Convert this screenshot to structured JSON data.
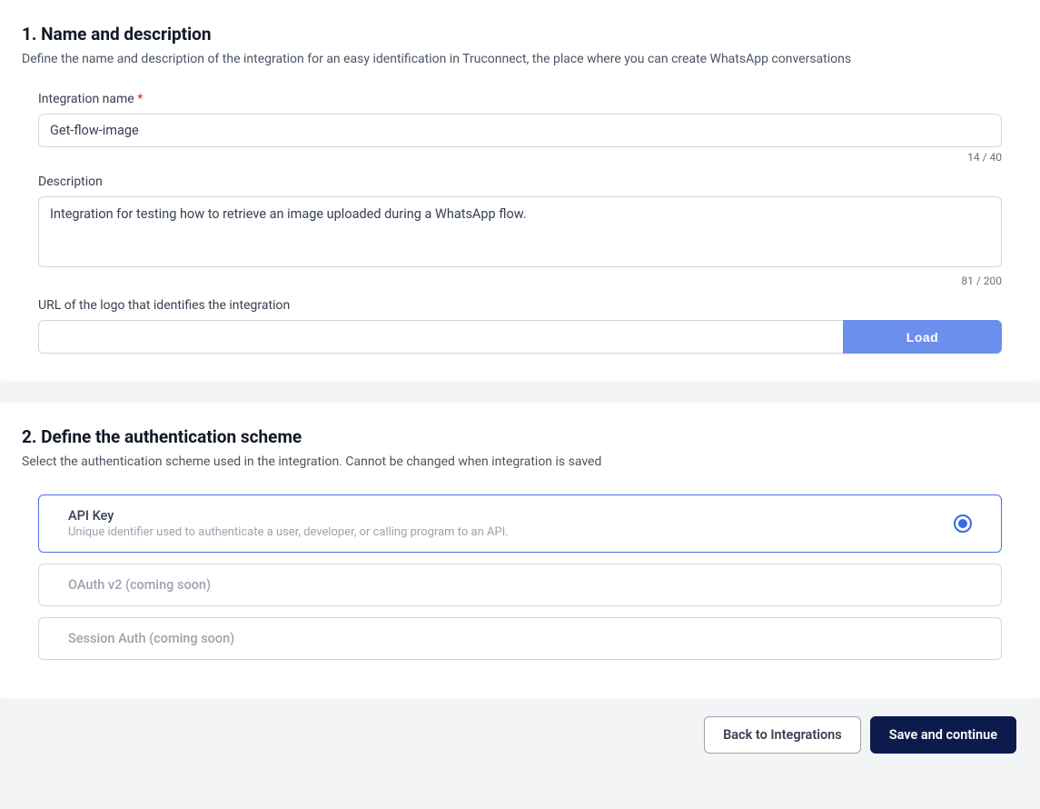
{
  "section1": {
    "title": "1. Name and description",
    "subtitle": "Define the name and description of the integration for an easy identification in Truconnect, the place where you can create WhatsApp conversations",
    "name_label": "Integration name",
    "name_value": "Get-flow-image",
    "name_counter": "14 / 40",
    "desc_label": "Description",
    "desc_value": "Integration for testing how to retrieve an image uploaded during a WhatsApp flow.",
    "desc_counter": "81 / 200",
    "logo_label": "URL of the logo that identifies the integration",
    "logo_value": "",
    "load_label": "Load"
  },
  "section2": {
    "title": "2. Define the authentication scheme",
    "subtitle": "Select the authentication scheme used in the integration. Cannot be changed when integration is saved",
    "options": [
      {
        "title": "API Key",
        "desc": "Unique identifier used to authenticate a user, developer, or calling program to an API."
      },
      {
        "title": "OAuth v2 (coming soon)"
      },
      {
        "title": "Session Auth (coming soon)"
      }
    ]
  },
  "footer": {
    "back": "Back to Integrations",
    "save": "Save and continue"
  }
}
